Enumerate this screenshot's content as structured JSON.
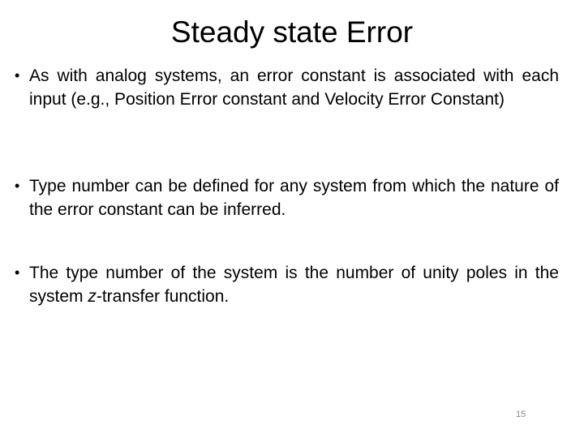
{
  "slide": {
    "title": "Steady state Error",
    "bullet_glyph": "•",
    "bullets": [
      {
        "text": "As with analog systems, an error constant is associated with each input (e.g., Position Error constant and Velocity Error Constant)"
      },
      {
        "text": "Type number can be defined for any system from which the nature of the error constant can be inferred."
      },
      {
        "text_before": "The type number of the system is the number of unity poles in the system ",
        "text_italic": "z",
        "text_after": "-transfer function."
      }
    ],
    "page_number": "15"
  }
}
